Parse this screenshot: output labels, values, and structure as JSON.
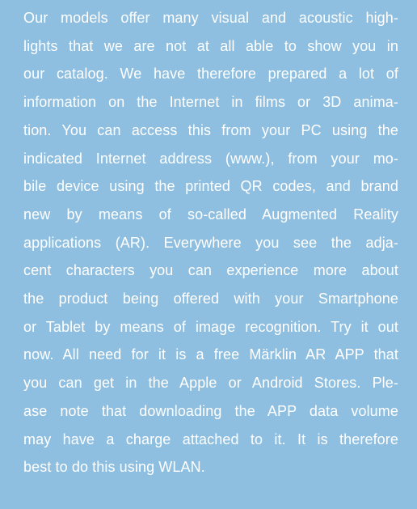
{
  "lines": [
    "Our models offer many visual and acoustic high-",
    "lights that we are not at all able to show you in",
    "our catalog. We have therefore prepared a lot of",
    "information on the Internet in films or 3D anima-",
    "tion. You can access this from your PC using the",
    "indicated Internet address (www.), from your mo-",
    "bile device using the printed QR codes, and brand",
    "new by means of so-called Augmented Reality",
    "applications (AR). Everywhere you see the adja-",
    "cent characters you can experience more about",
    "the product being offered with your Smartphone",
    "or Tablet by means of image recognition. Try it out",
    "now. All need for it is a free Märklin AR APP that",
    "you can get in the Apple or Android Stores. Ple-",
    "ase note that downloading the APP data volume",
    "may have a charge attached to it. It is therefore",
    "best to do this using WLAN."
  ],
  "colors": {
    "background": "#8fbfe0",
    "text": "#ffffff"
  }
}
